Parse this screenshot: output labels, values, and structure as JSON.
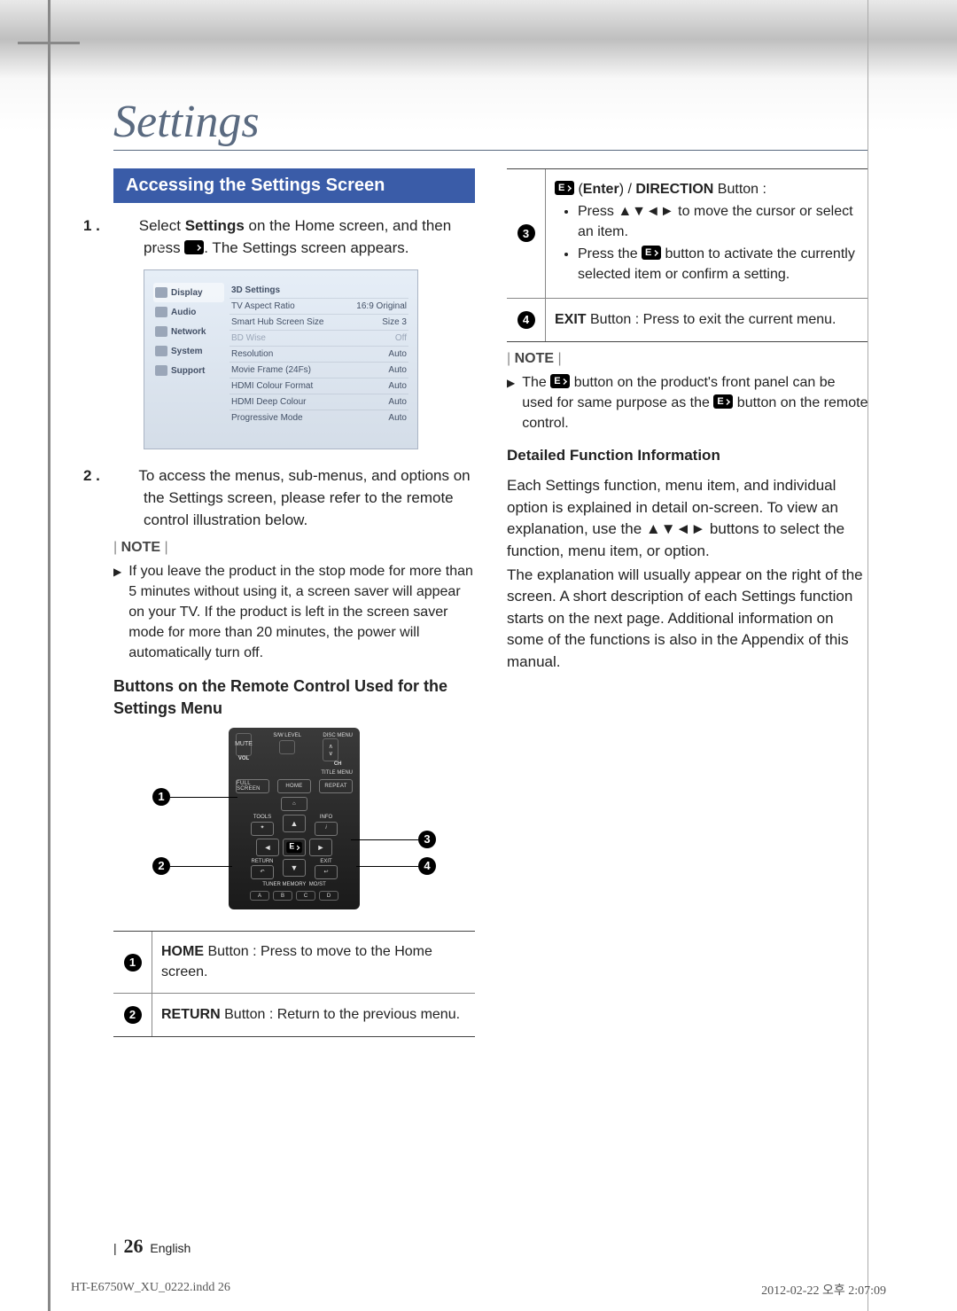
{
  "page_title": "Settings",
  "section_banner": "Accessing the Settings Screen",
  "step1_pre": "Select ",
  "step1_b": "Settings",
  "step1_mid": " on the Home screen, and then press ",
  "step1_post": ". The Settings screen appears.",
  "step2": "To access the menus, sub-menus, and options on the Settings screen, please refer to the remote control illustration below.",
  "note_label": "NOTE",
  "note_left": "If you leave the product in the stop mode for more than 5 minutes without using it, a screen saver will appear on your TV. If the product is left in the screen saver mode for more than 20 minutes, the power will automatically turn off.",
  "subhead_left": "Buttons on the Remote Control Used for the Settings Menu",
  "settings_mock": {
    "nav": [
      "Display",
      "Audio",
      "Network",
      "System",
      "Support"
    ],
    "head": "3D Settings",
    "opts": [
      {
        "l": "TV Aspect Ratio",
        "r": "16:9 Original"
      },
      {
        "l": "Smart Hub Screen Size",
        "r": "Size 3"
      },
      {
        "l": "BD Wise",
        "r": "Off",
        "muted": true
      },
      {
        "l": "Resolution",
        "r": "Auto"
      },
      {
        "l": "Movie Frame (24Fs)",
        "r": "Auto"
      },
      {
        "l": "HDMI Colour Format",
        "r": "Auto"
      },
      {
        "l": "HDMI Deep Colour",
        "r": "Auto"
      },
      {
        "l": "Progressive Mode",
        "r": "Auto"
      }
    ]
  },
  "remote_labels": {
    "vol": "VOL",
    "mute": "MUTE",
    "swlevel": "S/W LEVEL",
    "disc": "DISC MENU",
    "ch": "CH",
    "titlemenu": "TITLE MENU",
    "fullscreen": "FULL SCREEN",
    "home": "HOME",
    "repeat": "REPEAT",
    "tools": "TOOLS",
    "info": "INFO",
    "return": "RETURN",
    "exit": "EXIT",
    "tuner": "TUNER MEMORY",
    "most": "MO/ST",
    "a": "A",
    "b": "B",
    "c": "C",
    "d": "D"
  },
  "ftable": {
    "r1_b": "HOME",
    "r1": " Button : Press to move to the Home screen.",
    "r2_b": "RETURN",
    "r2": " Button : Return to the previous menu.",
    "r3_enter_b": "Enter",
    "r3_sep": ") / ",
    "r3_dir_b": "DIRECTION",
    "r3_dir_post": " Button :",
    "r3_li1": "Press ▲▼◄► to move the cursor or select an item.",
    "r3_li2_pre": "Press the ",
    "r3_li2_post": " button to activate the currently selected item or confirm a setting.",
    "r4_b": "EXIT",
    "r4": " Button : Press to exit the current menu."
  },
  "note_right_pre": "The ",
  "note_right_mid": " button on the product's front panel can be used for same purpose as the ",
  "note_right_post": " button on the remote control.",
  "subhead_right": "Detailed Function Information",
  "para_r1": "Each Settings function, menu item, and individual option is explained in detail on-screen. To view an explanation, use the ▲▼◄► buttons to select the function, menu item, or option.",
  "para_r2": "The explanation will usually appear on the right of the screen. A short description of each Settings function starts on the next page. Additional information on some of the functions is also in the Appendix of this manual.",
  "footer": {
    "bar": "|",
    "num": "26",
    "lang": "English"
  },
  "meta": {
    "left": "HT-E6750W_XU_0222.indd   26",
    "right": "2012-02-22   오후 2:07:09"
  }
}
